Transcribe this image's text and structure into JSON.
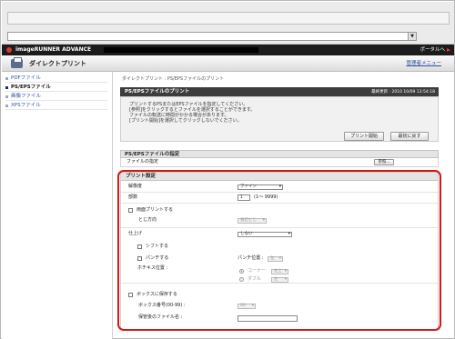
{
  "app": {
    "brand": "imageRUNNER ADVANCE",
    "portal_link": "ポータルへ",
    "page_title": "ダイレクトプリント",
    "menu_link": "管理者メニュー"
  },
  "sidebar": {
    "items": [
      {
        "label": "PDFファイル",
        "active": false
      },
      {
        "label": "PS/EPSファイル",
        "active": true
      },
      {
        "label": "画像ファイル",
        "active": false
      },
      {
        "label": "XPSファイル",
        "active": false
      }
    ]
  },
  "breadcrumb": "ダイレクトプリント : PS/EPSファイルのプリント",
  "section": {
    "title": "PS/EPSファイルのプリント",
    "timestamp": "最終更新 : 2010 10/09 13:54:18"
  },
  "instructions": [
    "プリントするPSまたはEPSファイルを指定してください。",
    "[参照]をクリックするとファイルを選択することができます。",
    "ファイルの転送に時間がかかる場合があります。",
    "[プリント開始]を選択してクリックしないでください。"
  ],
  "buttons": {
    "start_print": "プリント開始",
    "reset": "最初に戻す",
    "browse": "参照..."
  },
  "file_spec": {
    "header": "PS/EPSファイルの指定",
    "label": "ファイルの指定"
  },
  "print_settings": {
    "header": "プリント設定",
    "resolution": {
      "label": "解像度",
      "value": "ファイン"
    },
    "copies": {
      "label": "部数",
      "value": "1",
      "range": "(1～ 9999)"
    },
    "duplex": {
      "label": "両面プリントする",
      "checked": false
    },
    "binding": {
      "label": "とじ方向",
      "value": "長辺とじ"
    },
    "finishing": {
      "label": "仕上げ",
      "value": "しない"
    },
    "shift": {
      "label": "シフトする",
      "checked": false
    },
    "punch": {
      "label": "パンチする",
      "checked": false
    },
    "punch_position": {
      "label": "パンチ位置 :",
      "value": "左"
    },
    "staple_position": {
      "label": "ホチキス位置 :",
      "corner_label": "コーナー",
      "corner_value": "左上",
      "double_label": "ダブル",
      "double_value": "左",
      "selected": "corner"
    },
    "save_to_box": {
      "label": "ボックスに保存する",
      "checked": false
    },
    "box_number": {
      "label": "ボックス番号(00-99) :",
      "value": "00"
    },
    "saved_file_name": {
      "label": "保管後のファイル名 :",
      "value": ""
    }
  },
  "colors": {
    "header_bg": "#1c1c1c",
    "section_bar": "#3c3c3c",
    "link": "#2d4fa0",
    "highlight": "#d01818"
  }
}
